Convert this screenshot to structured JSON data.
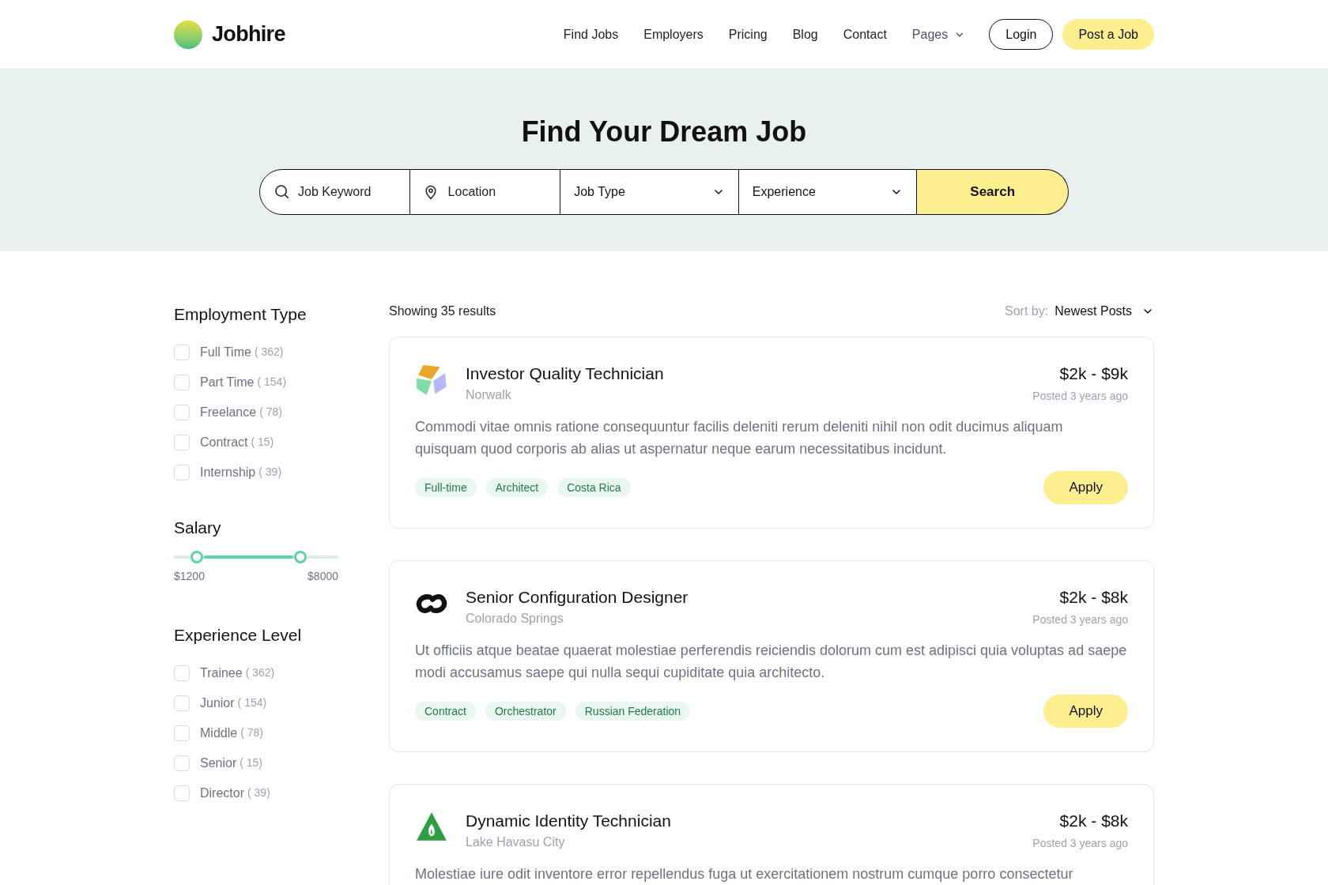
{
  "header": {
    "logo": "Jobhire",
    "nav": [
      {
        "label": "Find Jobs",
        "kind": "link"
      },
      {
        "label": "Employers",
        "kind": "link"
      },
      {
        "label": "Pricing",
        "kind": "link"
      },
      {
        "label": "Blog",
        "kind": "link"
      },
      {
        "label": "Contact",
        "kind": "link"
      },
      {
        "label": "Pages",
        "kind": "dropdown"
      }
    ],
    "login": "Login",
    "post": "Post a Job"
  },
  "hero": {
    "title": "Find Your Dream Job",
    "fields": [
      {
        "kind": "search",
        "placeholder": "Job Keyword"
      },
      {
        "kind": "location",
        "placeholder": "Location"
      },
      {
        "kind": "select",
        "value": "Job Type"
      },
      {
        "kind": "select",
        "value": "Experience"
      }
    ],
    "button": "Search"
  },
  "sidebar": {
    "employment": {
      "title": "Employment Type",
      "items": [
        {
          "label": "Full Time",
          "count": "( 362)",
          "checked": false
        },
        {
          "label": "Part Time",
          "count": "( 154)",
          "checked": false
        },
        {
          "label": "Freelance",
          "count": "( 78)",
          "checked": false
        },
        {
          "label": "Contract",
          "count": "( 15)",
          "checked": false
        },
        {
          "label": "Internship",
          "count": "( 39)",
          "checked": false
        }
      ]
    },
    "salary": {
      "title": "Salary",
      "thumbs": [
        {
          "level": 0.14,
          "reading": "$1200"
        },
        {
          "level": 0.77,
          "reading": "$8000"
        }
      ]
    },
    "experience": {
      "title": "Experience Level",
      "items": [
        {
          "label": "Trainee",
          "count": "( 362)",
          "checked": false
        },
        {
          "label": "Junior",
          "count": "( 154)",
          "checked": false
        },
        {
          "label": "Middle",
          "count": "( 78)",
          "checked": false
        },
        {
          "label": "Senior",
          "count": "( 15)",
          "checked": false
        },
        {
          "label": "Director",
          "count": "( 39)",
          "checked": false
        }
      ]
    }
  },
  "results": {
    "showing": "Showing 35 results",
    "sort_label": "Sort by:",
    "sort_value": "Newest Posts",
    "jobs": [
      {
        "kind": "pinwheel",
        "title": "Investor Quality Technician",
        "location": "Norwalk",
        "salary": "$2k - $9k",
        "posted": "Posted 3 years ago",
        "description": "Commodi vitae omnis ratione consequuntur facilis deleniti rerum deleniti nihil non odit ducimus aliquam quisquam quod corporis ab alias ut aspernatur neque earum necessitatibus incidunt.",
        "tags": [
          "Full-time",
          "Architect",
          "Costa Rica"
        ],
        "apply": "Apply"
      },
      {
        "kind": "chain",
        "title": "Senior Configuration Designer",
        "location": "Colorado Springs",
        "salary": "$2k - $8k",
        "posted": "Posted 3 years ago",
        "description": "Ut officiis atque beatae quaerat molestiae perferendis reiciendis dolorum cum est adipisci quia voluptas ad saepe modi accusamus saepe qui nulla sequi cupiditate quia architecto.",
        "tags": [
          "Contract",
          "Orchestrator",
          "Russian Federation"
        ],
        "apply": "Apply"
      },
      {
        "kind": "leaf",
        "title": "Dynamic Identity Technician",
        "location": "Lake Havasu City",
        "salary": "$2k - $8k",
        "posted": "Posted 3 years ago",
        "description": "Molestiae iure odit inventore error repellendus fuga ut exercitationem nostrum cumque porro consectetur"
      }
    ]
  }
}
